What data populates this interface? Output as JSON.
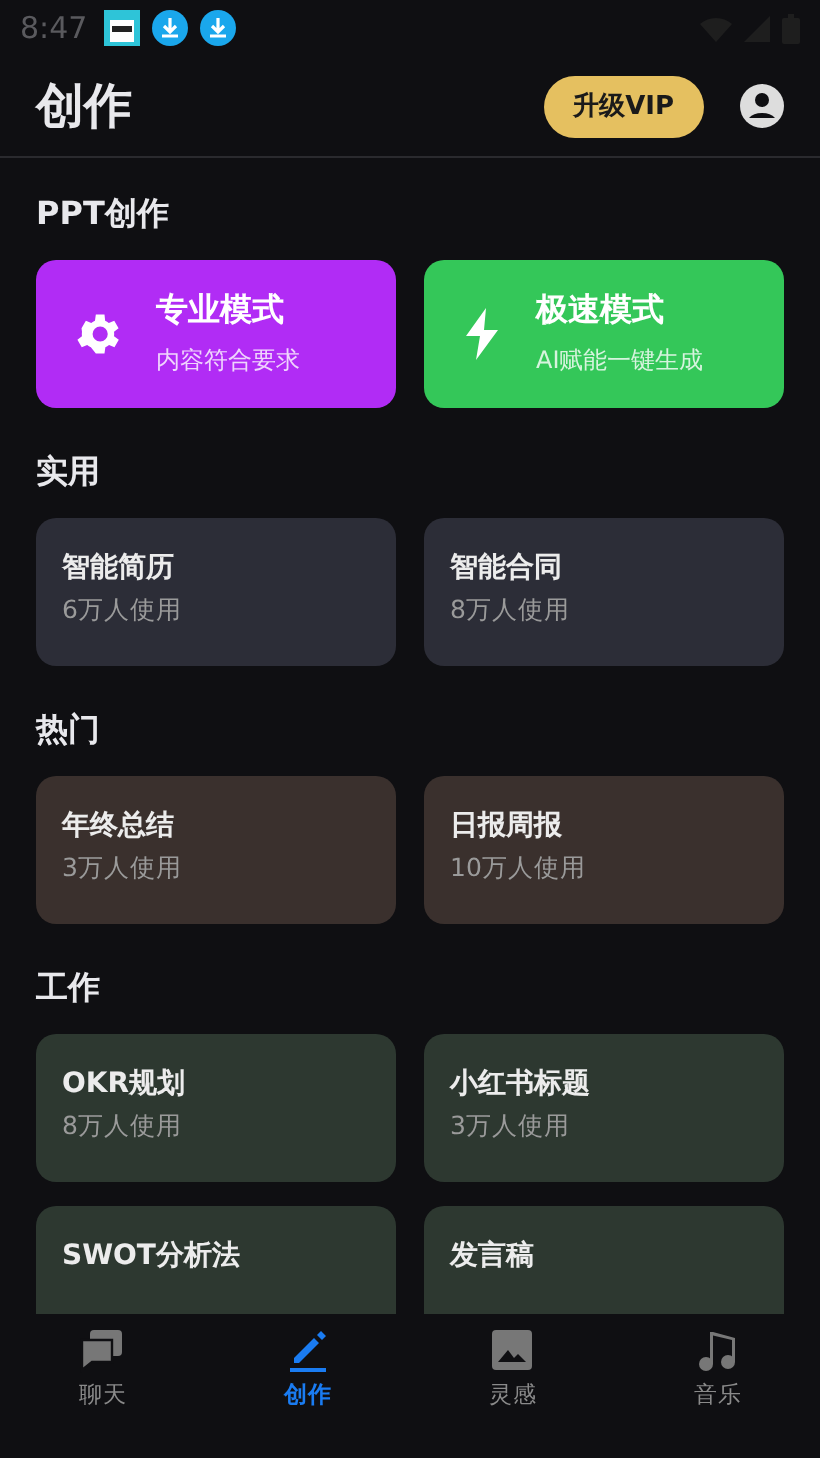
{
  "status_bar": {
    "time": "8:47"
  },
  "header": {
    "title": "创作",
    "vip_button": "升级VIP"
  },
  "ppt": {
    "title": "PPT创作",
    "modes": [
      {
        "kind": "gear",
        "title": "专业模式",
        "subtitle": "内容符合要求",
        "color": "#b12cf5"
      },
      {
        "kind": "bolt",
        "title": "极速模式",
        "subtitle": "AI赋能一键生成",
        "color": "#34c759"
      }
    ]
  },
  "sections": [
    {
      "title": "实用",
      "color": "#2c2d37",
      "cards": [
        {
          "title": "智能简历",
          "usage": "6万人使用"
        },
        {
          "title": "智能合同",
          "usage": "8万人使用"
        }
      ]
    },
    {
      "title": "热门",
      "color": "#3a302d",
      "cards": [
        {
          "title": "年终总结",
          "usage": "3万人使用"
        },
        {
          "title": "日报周报",
          "usage": "10万人使用"
        }
      ]
    },
    {
      "title": "工作",
      "color": "#2d3830",
      "cards": [
        {
          "title": "OKR规划",
          "usage": "8万人使用"
        },
        {
          "title": "小红书标题",
          "usage": "3万人使用"
        },
        {
          "title": "SWOT分析法"
        },
        {
          "title": "发言稿"
        }
      ]
    }
  ],
  "nav": [
    {
      "kind": "chat",
      "label": "聊天",
      "selected": false
    },
    {
      "kind": "pen",
      "label": "创作",
      "selected": true
    },
    {
      "kind": "image",
      "label": "灵感",
      "selected": false
    },
    {
      "kind": "music",
      "label": "音乐",
      "selected": false
    }
  ]
}
